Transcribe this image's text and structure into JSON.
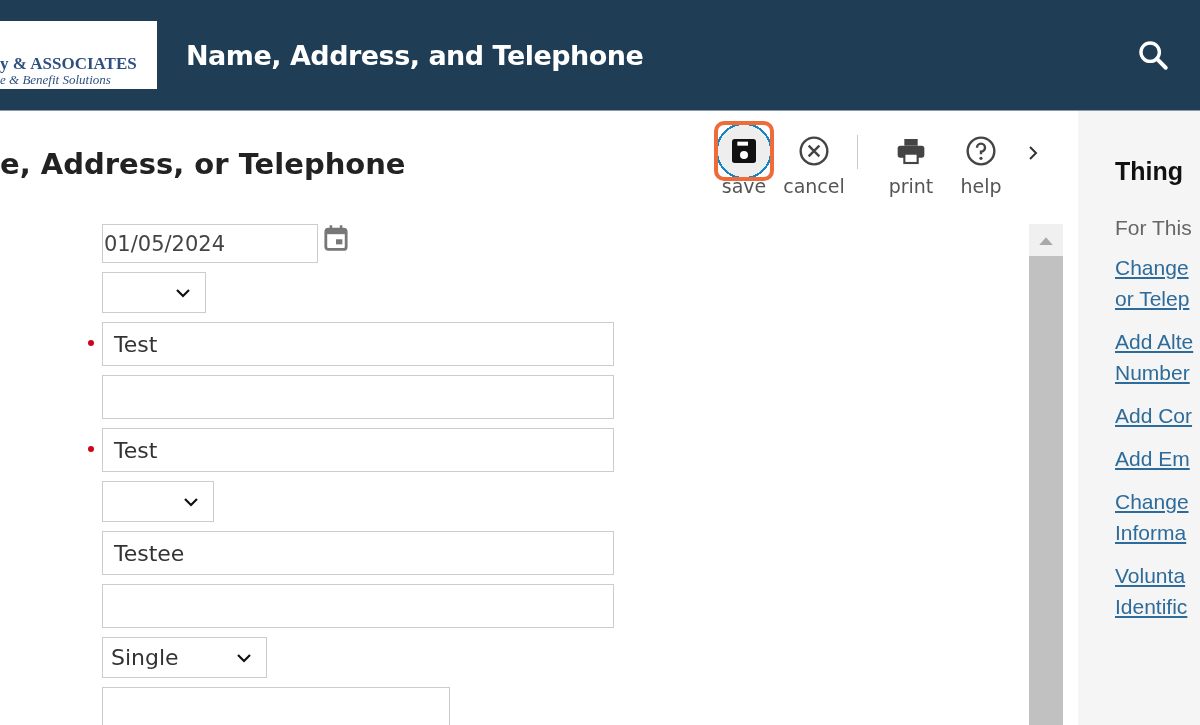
{
  "header": {
    "logo": {
      "line_1": "y & ASSOCIATES",
      "line_2": "e & Benefit Solutions"
    },
    "title": "Name, Address, and Telephone"
  },
  "page_title": "e, Address, or Telephone",
  "toolbar": [
    {
      "kind": "save",
      "label": "save",
      "selected": true
    },
    {
      "kind": "cancel",
      "label": "cancel",
      "selected": false
    },
    {
      "kind": "separator"
    },
    {
      "kind": "print",
      "label": "print",
      "selected": false
    },
    {
      "kind": "help",
      "label": "help",
      "selected": false
    },
    {
      "kind": "more"
    }
  ],
  "form_fields": [
    {
      "kind": "date",
      "value": "01/05/2024",
      "required": false
    },
    {
      "kind": "select",
      "required": false
    },
    {
      "kind": "text",
      "value": "Test",
      "required": true
    },
    {
      "kind": "text",
      "required": false
    },
    {
      "kind": "text",
      "value": "Test",
      "required": true
    },
    {
      "kind": "select",
      "required": false
    },
    {
      "kind": "text",
      "value": "Testee",
      "required": false
    },
    {
      "kind": "text",
      "required": false
    },
    {
      "kind": "select",
      "value": "Single",
      "required": false
    },
    {
      "kind": "text",
      "required": false
    }
  ],
  "sidebar": {
    "heading": "Thing",
    "subheading": "For This",
    "links": [
      [
        "Change",
        "or Telep"
      ],
      [
        "Add Alte",
        "Number"
      ],
      [
        "Add Cor"
      ],
      [
        "Add Em"
      ],
      [
        "Change",
        "Informa"
      ],
      [
        "Volunta",
        "Identific"
      ]
    ]
  }
}
